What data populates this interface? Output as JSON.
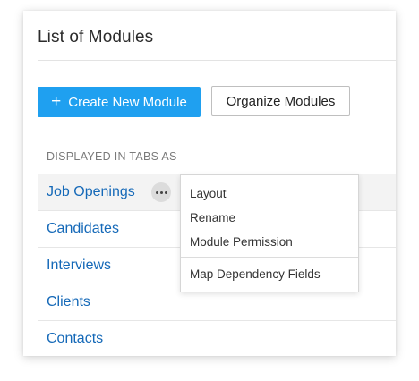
{
  "page": {
    "title": "List of Modules"
  },
  "actions": {
    "create_label": "Create New Module",
    "organize_label": "Organize Modules"
  },
  "list": {
    "header": "DISPLAYED IN TABS AS",
    "items": [
      {
        "label": "Job Openings"
      },
      {
        "label": "Candidates"
      },
      {
        "label": "Interviews"
      },
      {
        "label": "Clients"
      },
      {
        "label": "Contacts"
      }
    ]
  },
  "context_menu": {
    "items": [
      {
        "label": "Layout"
      },
      {
        "label": "Rename"
      },
      {
        "label": "Module Permission"
      },
      {
        "label": "Map Dependency Fields"
      }
    ]
  },
  "colors": {
    "accent": "#1fa0f0",
    "link": "#1569b8"
  },
  "icons": {
    "create": "plus-icon",
    "more": "more-options-icon"
  }
}
